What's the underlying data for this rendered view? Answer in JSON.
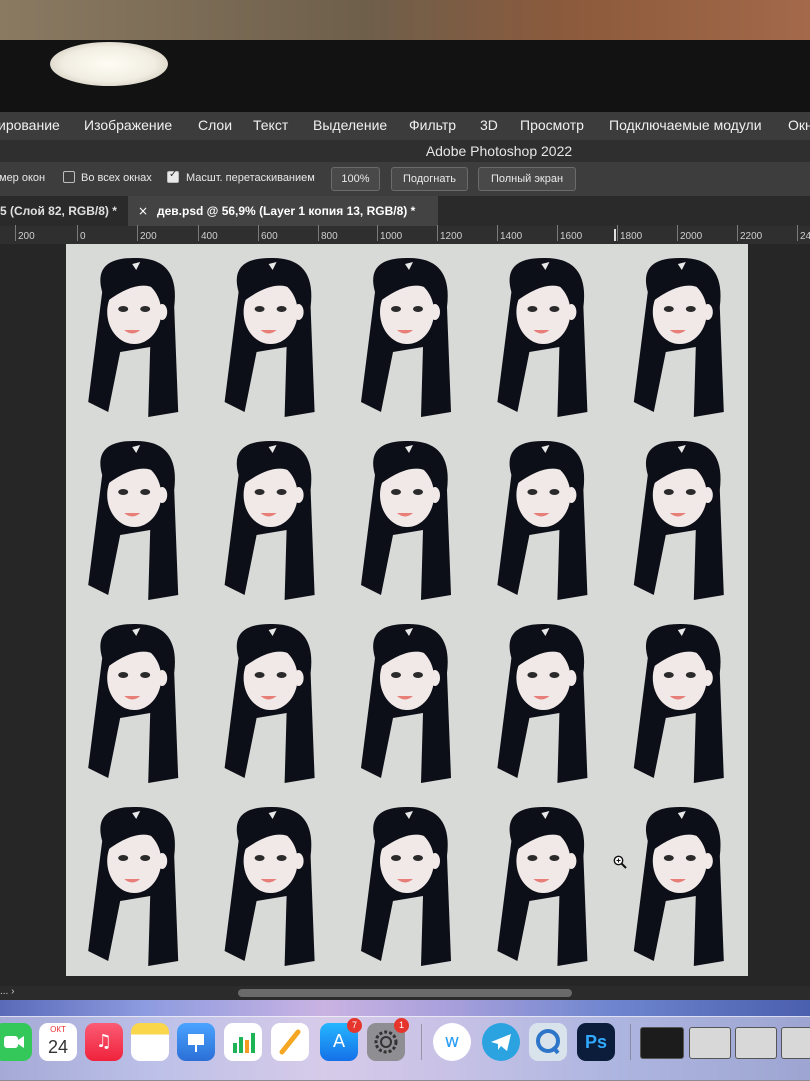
{
  "menu": {
    "items": [
      "ирование",
      "Изображение",
      "Слои",
      "Текст",
      "Выделение",
      "Фильтр",
      "3D",
      "Просмотр",
      "Подключаемые модули",
      "Окн"
    ]
  },
  "app": {
    "title": "Adobe Photoshop 2022"
  },
  "options": {
    "window_size_label": "мер окон",
    "all_windows_label": "Во всех окнах",
    "all_windows_checked": false,
    "scrubby_zoom_label": "Масшт. перетаскиванием",
    "scrubby_zoom_checked": true,
    "zoom_value": "100%",
    "fit_label": "Подогнать",
    "full_screen_label": "Полный экран"
  },
  "tabs": [
    {
      "label": "5 (Слой 82, RGB/8) *",
      "active": false
    },
    {
      "label": "дев.psd @ 56,9% (Layer 1 копия 13, RGB/8) *",
      "active": true
    }
  ],
  "tab_close_glyph": "×",
  "ruler": {
    "ticks": [
      "200",
      "0",
      "200",
      "400",
      "600",
      "800",
      "1000",
      "1200",
      "1400",
      "1600",
      "1800",
      "2000",
      "2200",
      "24"
    ]
  },
  "status": {
    "left_text": "... ›"
  },
  "canvas": {
    "background": "#d7dad6",
    "grid_rows": 4,
    "grid_cols": 5,
    "hair_color": "#0d0f18",
    "skin_color": "#f1e9e8",
    "lip_color": "#e77e78"
  },
  "dock": {
    "calendar_month": "ОКТ",
    "calendar_day": "24",
    "appstore_badge": "7",
    "settings_badge": "1",
    "ps_label": "Ps",
    "items": [
      "facetime-icon",
      "calendar-icon",
      "music-icon",
      "notes-icon",
      "keynote-icon",
      "numbers-icon",
      "pages-icon",
      "appstore-icon",
      "settings-icon",
      "wps-icon",
      "telegram-icon",
      "quicktime-icon",
      "photoshop-icon"
    ]
  }
}
